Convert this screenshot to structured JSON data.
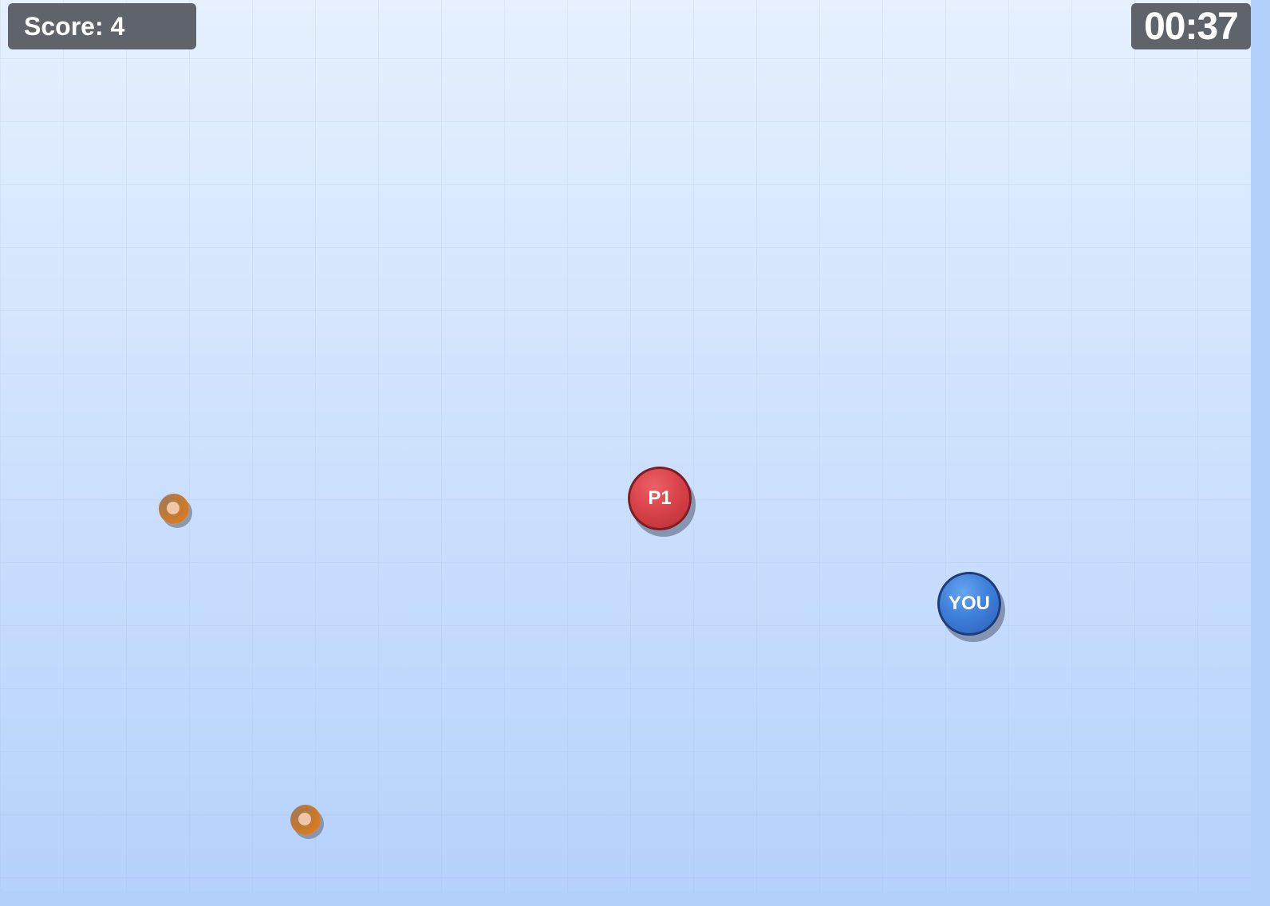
{
  "hud": {
    "score_text": "Score: 4",
    "timer_text": "00:37"
  },
  "players": {
    "p1": {
      "label": "P1",
      "color": "#d9444b"
    },
    "you": {
      "label": "YOU",
      "color": "#3f80da"
    }
  },
  "pickups": [
    {
      "color": "#ee7f16"
    },
    {
      "color": "#ee7f16"
    }
  ]
}
